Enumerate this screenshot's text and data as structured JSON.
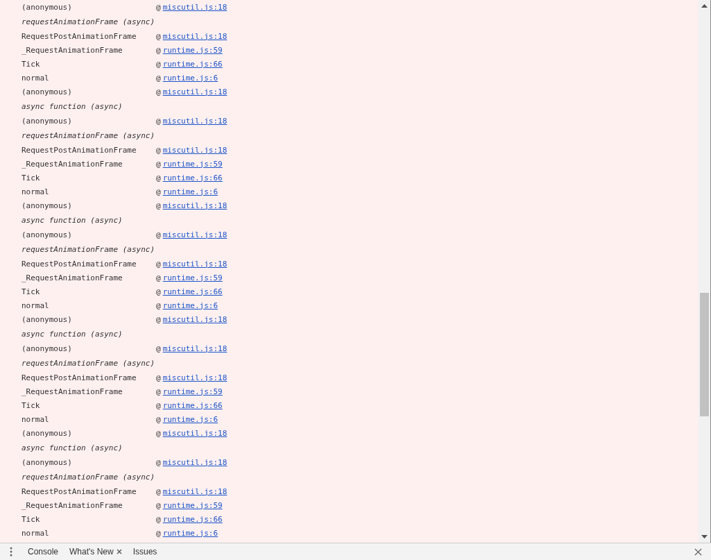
{
  "stack_frames": [
    {
      "kind": "call",
      "function": "(anonymous)",
      "at": "@",
      "source": "miscutil.js:18"
    },
    {
      "kind": "async",
      "function": "requestAnimationFrame (async)"
    },
    {
      "kind": "call",
      "function": "RequestPostAnimationFrame",
      "at": "@",
      "source": "miscutil.js:18"
    },
    {
      "kind": "call",
      "function": "_RequestAnimationFrame",
      "at": "@",
      "source": "runtime.js:59"
    },
    {
      "kind": "call",
      "function": "Tick",
      "at": "@",
      "source": "runtime.js:66"
    },
    {
      "kind": "call",
      "function": "normal",
      "at": "@",
      "source": "runtime.js:6"
    },
    {
      "kind": "call",
      "function": "(anonymous)",
      "at": "@",
      "source": "miscutil.js:18"
    },
    {
      "kind": "async",
      "function": "async function (async)"
    },
    {
      "kind": "call",
      "function": "(anonymous)",
      "at": "@",
      "source": "miscutil.js:18"
    },
    {
      "kind": "async",
      "function": "requestAnimationFrame (async)"
    },
    {
      "kind": "call",
      "function": "RequestPostAnimationFrame",
      "at": "@",
      "source": "miscutil.js:18"
    },
    {
      "kind": "call",
      "function": "_RequestAnimationFrame",
      "at": "@",
      "source": "runtime.js:59"
    },
    {
      "kind": "call",
      "function": "Tick",
      "at": "@",
      "source": "runtime.js:66"
    },
    {
      "kind": "call",
      "function": "normal",
      "at": "@",
      "source": "runtime.js:6"
    },
    {
      "kind": "call",
      "function": "(anonymous)",
      "at": "@",
      "source": "miscutil.js:18"
    },
    {
      "kind": "async",
      "function": "async function (async)"
    },
    {
      "kind": "call",
      "function": "(anonymous)",
      "at": "@",
      "source": "miscutil.js:18"
    },
    {
      "kind": "async",
      "function": "requestAnimationFrame (async)"
    },
    {
      "kind": "call",
      "function": "RequestPostAnimationFrame",
      "at": "@",
      "source": "miscutil.js:18"
    },
    {
      "kind": "call",
      "function": "_RequestAnimationFrame",
      "at": "@",
      "source": "runtime.js:59"
    },
    {
      "kind": "call",
      "function": "Tick",
      "at": "@",
      "source": "runtime.js:66"
    },
    {
      "kind": "call",
      "function": "normal",
      "at": "@",
      "source": "runtime.js:6"
    },
    {
      "kind": "call",
      "function": "(anonymous)",
      "at": "@",
      "source": "miscutil.js:18"
    },
    {
      "kind": "async",
      "function": "async function (async)"
    },
    {
      "kind": "call",
      "function": "(anonymous)",
      "at": "@",
      "source": "miscutil.js:18"
    },
    {
      "kind": "async",
      "function": "requestAnimationFrame (async)"
    },
    {
      "kind": "call",
      "function": "RequestPostAnimationFrame",
      "at": "@",
      "source": "miscutil.js:18"
    },
    {
      "kind": "call",
      "function": "_RequestAnimationFrame",
      "at": "@",
      "source": "runtime.js:59"
    },
    {
      "kind": "call",
      "function": "Tick",
      "at": "@",
      "source": "runtime.js:66"
    },
    {
      "kind": "call",
      "function": "normal",
      "at": "@",
      "source": "runtime.js:6"
    },
    {
      "kind": "call",
      "function": "(anonymous)",
      "at": "@",
      "source": "miscutil.js:18"
    },
    {
      "kind": "async",
      "function": "async function (async)"
    },
    {
      "kind": "call",
      "function": "(anonymous)",
      "at": "@",
      "source": "miscutil.js:18"
    },
    {
      "kind": "async",
      "function": "requestAnimationFrame (async)"
    },
    {
      "kind": "call",
      "function": "RequestPostAnimationFrame",
      "at": "@",
      "source": "miscutil.js:18"
    },
    {
      "kind": "call",
      "function": "_RequestAnimationFrame",
      "at": "@",
      "source": "runtime.js:59"
    },
    {
      "kind": "call",
      "function": "Tick",
      "at": "@",
      "source": "runtime.js:66"
    },
    {
      "kind": "call",
      "function": "normal",
      "at": "@",
      "source": "runtime.js:6"
    }
  ],
  "drawer_tabs": [
    {
      "label": "Console",
      "closable": false,
      "selected": false
    },
    {
      "label": "What's New",
      "closable": true,
      "selected": false
    },
    {
      "label": "Issues",
      "closable": false,
      "selected": false
    }
  ]
}
